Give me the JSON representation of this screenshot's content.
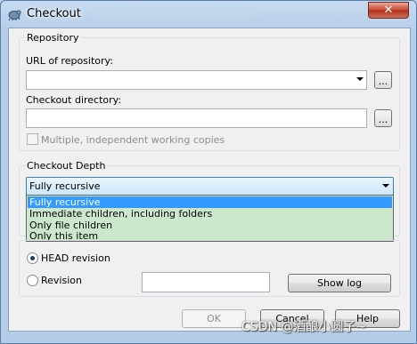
{
  "window": {
    "title": "Checkout",
    "close_label": "✕"
  },
  "repository": {
    "group_label": "Repository",
    "url_label": "URL of repository:",
    "url_value": "",
    "url_browse_label": "...",
    "dir_label": "Checkout directory:",
    "dir_value": "",
    "dir_browse_label": "...",
    "multiple_wc_label": "Multiple, independent working copies",
    "multiple_wc_checked": false
  },
  "depth": {
    "group_label": "Checkout Depth",
    "selected": "Fully recursive",
    "options": [
      "Fully recursive",
      "Immediate children, including folders",
      "Only file children",
      "Only this item"
    ],
    "dropdown_bg": "#cce8cc",
    "highlight": "#3399ff"
  },
  "revision": {
    "head_label": "HEAD revision",
    "head_checked": true,
    "revision_label": "Revision",
    "revision_value": "",
    "show_log_label": "Show log"
  },
  "buttons": {
    "ok": "OK",
    "cancel": "Cancel",
    "help": "Help"
  },
  "watermark": "CSDN @酒酿小圆子~"
}
